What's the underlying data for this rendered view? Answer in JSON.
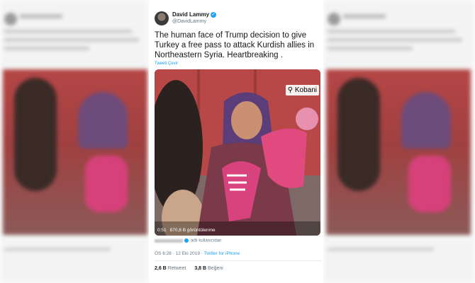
{
  "tweet": {
    "name": "David Lammy",
    "handle": "@DavidLammy",
    "text": "The human face of Trump decision to give Turkey a free pass to attack Kurdish allies in Northeastern Syria. Heartbreaking .",
    "translate_label": "Tweeti Çevir",
    "media": {
      "location": "Kobani",
      "duration": "0:51",
      "views": "870,8 B görüntülenme"
    },
    "attribution": "adlı kullanıcıdan",
    "time": "ÖS 6:28",
    "date": "12 Eki 2019",
    "separator": "·",
    "source": "Twitter for iPhone",
    "retweets_count": "2,6 B",
    "retweets_label": "Retweet",
    "likes_count": "3,8 B",
    "likes_label": "Beğeni"
  },
  "colors": {
    "link": "#1da1f2",
    "text": "#14171a",
    "muted": "#657786"
  },
  "icons": [
    "verified-icon",
    "location-pin-icon"
  ]
}
